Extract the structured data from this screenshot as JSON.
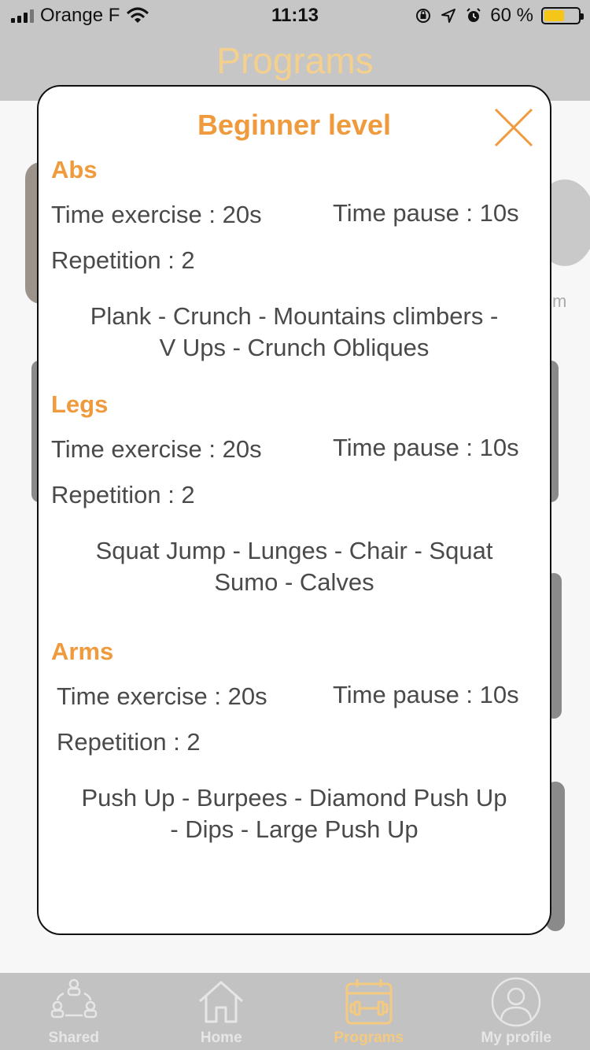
{
  "status_bar": {
    "carrier": "Orange F",
    "time": "11:13",
    "battery_text": "60 %",
    "battery_level": 0.6,
    "battery_color": "#f5c518"
  },
  "header": {
    "title": "Programs",
    "title_color": "#f4d08c"
  },
  "background": {
    "partial_text": "m"
  },
  "modal": {
    "title": "Beginner level",
    "accent_color": "#ef9a3c",
    "sections": [
      {
        "title": "Abs",
        "time_exercise": "Time exercise : 20s",
        "time_pause": "Time pause : 10s",
        "repetition": "Repetition : 2",
        "exercises_line1": "Plank - Crunch - Mountains climbers -",
        "exercises_line2": "V Ups - Crunch Obliques"
      },
      {
        "title": "Legs",
        "time_exercise": "Time exercise : 20s",
        "time_pause": "Time pause : 10s",
        "repetition": "Repetition : 2",
        "exercises_line1": "Squat Jump - Lunges - Chair - Squat",
        "exercises_line2": "Sumo - Calves"
      },
      {
        "title": "Arms",
        "time_exercise": "Time exercise : 20s",
        "time_pause": "Time pause : 10s",
        "repetition": "Repetition : 2",
        "exercises_line1": "Push Up - Burpees - Diamond Push Up",
        "exercises_line2": "- Dips - Large Push Up"
      }
    ]
  },
  "tab_bar": {
    "tabs": [
      {
        "label": "Shared",
        "icon": "shared-icon",
        "active": false
      },
      {
        "label": "Home",
        "icon": "home-icon",
        "active": false
      },
      {
        "label": "Programs",
        "icon": "calendar-dumbbell-icon",
        "active": true
      },
      {
        "label": "My profile",
        "icon": "profile-icon",
        "active": false
      }
    ]
  }
}
